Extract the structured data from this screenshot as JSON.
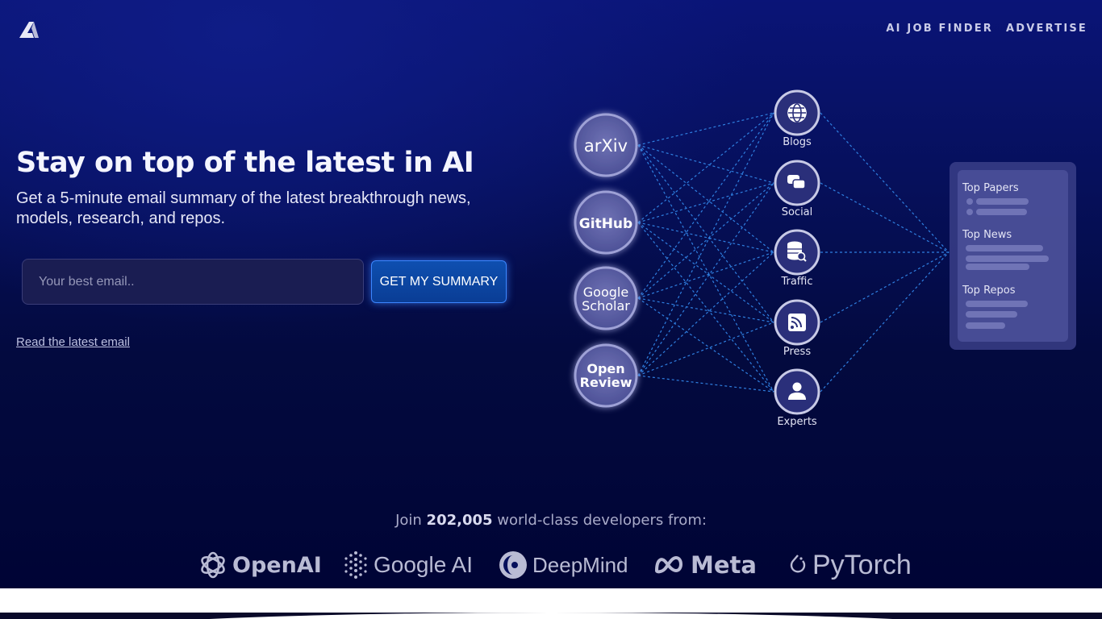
{
  "nav": {
    "logo_icon": "stylized-a-logo-icon",
    "items": [
      "AI JOB FINDER",
      "ADVERTISE"
    ]
  },
  "hero": {
    "headline": "Stay on top of the latest in AI",
    "subhead": "Get a 5-minute email summary of the latest breakthrough news, models, research, and repos.",
    "email_placeholder": "Your best email..",
    "cta_label": "GET MY SUMMARY",
    "read_link": "Read the latest email"
  },
  "diagram": {
    "sources": [
      "arXiv",
      "GitHub",
      "Google Scholar",
      "Open Review"
    ],
    "channels": [
      {
        "label": "Blogs",
        "icon": "globe-icon"
      },
      {
        "label": "Social",
        "icon": "chat-bubbles-icon"
      },
      {
        "label": "Traffic",
        "icon": "database-search-icon"
      },
      {
        "label": "Press",
        "icon": "rss-icon"
      },
      {
        "label": "Experts",
        "icon": "person-icon"
      }
    ],
    "summary_sections": [
      "Top Papers",
      "Top News",
      "Top Repos"
    ]
  },
  "social_proof": {
    "prefix": "Join",
    "count": "202,005",
    "suffix": "world-class developers from:"
  },
  "partners": [
    "OpenAI",
    "Google AI",
    "DeepMind",
    "Meta",
    "PyTorch"
  ],
  "colors": {
    "background": "#06105c",
    "accent": "#0e4fb0",
    "link_line": "#2f7fe0"
  }
}
